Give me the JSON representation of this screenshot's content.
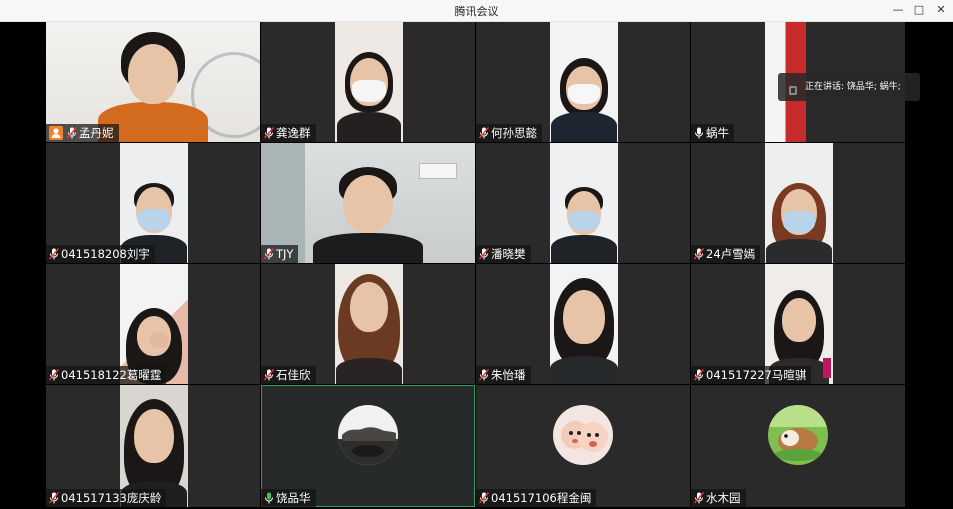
{
  "window": {
    "title": "腾讯会议",
    "minimize_label": "—",
    "maximize_label": "□",
    "close_label": "✕"
  },
  "speaking_indicator": {
    "text": "正在讲话: 饶品华; 蜗牛;"
  },
  "colors": {
    "host_badge": "#f0832a",
    "active_border": "#2f9e5a",
    "unmuted_mic": "#3fbf5f"
  },
  "participants": [
    {
      "name": "孟丹妮",
      "mic": "muted",
      "host": true,
      "video": true
    },
    {
      "name": "龚逸群",
      "mic": "muted",
      "host": false,
      "video": true
    },
    {
      "name": "何孙思懿",
      "mic": "muted",
      "host": false,
      "video": true
    },
    {
      "name": "蜗牛",
      "mic": "on",
      "host": false,
      "video": true
    },
    {
      "name": "041518208刘宇",
      "mic": "muted",
      "host": false,
      "video": true
    },
    {
      "name": "TJY",
      "mic": "muted",
      "host": false,
      "video": true
    },
    {
      "name": "潘晓樊",
      "mic": "muted",
      "host": false,
      "video": true
    },
    {
      "name": "24卢雪嫣",
      "mic": "muted",
      "host": false,
      "video": true
    },
    {
      "name": "041518122葛曜霆",
      "mic": "muted",
      "host": false,
      "video": true
    },
    {
      "name": "石佳欣",
      "mic": "muted",
      "host": false,
      "video": true
    },
    {
      "name": "朱怡璠",
      "mic": "muted",
      "host": false,
      "video": true
    },
    {
      "name": "041517227马暄骐",
      "mic": "muted",
      "host": false,
      "video": true
    },
    {
      "name": "041517133庞庆龄",
      "mic": "muted",
      "host": false,
      "video": true
    },
    {
      "name": "饶品华",
      "mic": "speaking",
      "host": false,
      "video": false,
      "avatar": "landscape-avatar"
    },
    {
      "name": "041517106程金闽",
      "mic": "muted",
      "host": false,
      "video": false,
      "avatar": "child-avatar"
    },
    {
      "name": "水木园",
      "mic": "muted",
      "host": false,
      "video": false,
      "avatar": "guinea-pig-avatar"
    }
  ]
}
